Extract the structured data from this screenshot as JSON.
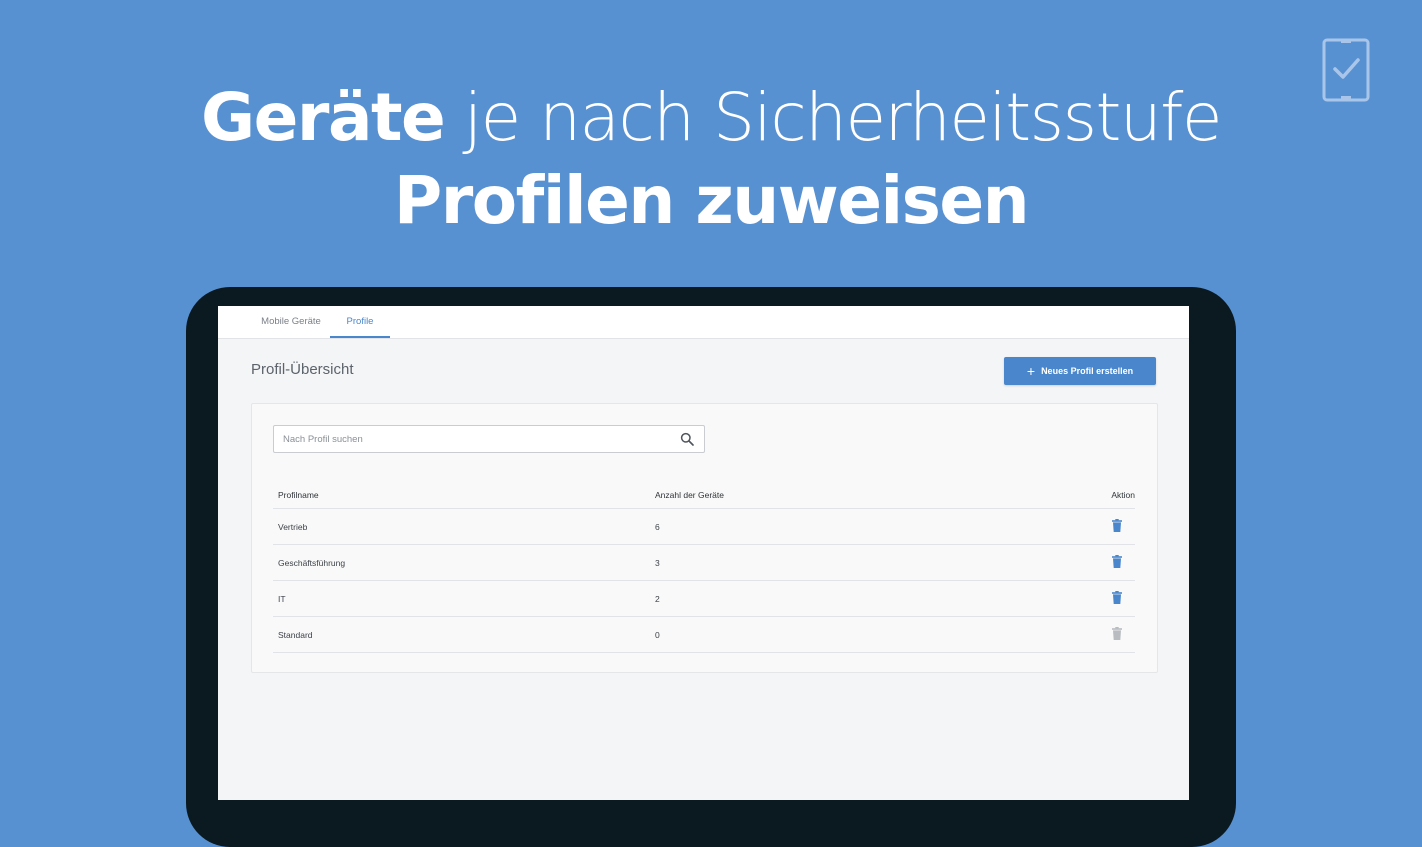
{
  "headline": {
    "line1_bold": "Geräte",
    "line1_rest": " je nach Sicherheitsstufe",
    "line2": "Profilen zuweisen"
  },
  "logo_icon": "tablet-check-icon",
  "tabs": [
    {
      "label": "Mobile Geräte",
      "active": false
    },
    {
      "label": "Profile",
      "active": true
    }
  ],
  "page_title": "Profil-Übersicht",
  "new_profile_button": {
    "icon": "plus-icon",
    "label": "Neues Profil erstellen"
  },
  "search": {
    "placeholder": "Nach Profil suchen",
    "value": "",
    "icon": "search-icon"
  },
  "table": {
    "headers": {
      "name": "Profilname",
      "count": "Anzahl der Geräte",
      "action": "Aktion"
    },
    "rows": [
      {
        "name": "Vertrieb",
        "count": "6",
        "delete_enabled": true
      },
      {
        "name": "Geschäftsführung",
        "count": "3",
        "delete_enabled": true
      },
      {
        "name": "IT",
        "count": "2",
        "delete_enabled": true
      },
      {
        "name": "Standard",
        "count": "0",
        "delete_enabled": false
      }
    ]
  },
  "colors": {
    "background": "#5891d2",
    "accent": "#4a86cc",
    "device_frame": "#0b1a21",
    "trash_disabled": "#b8bcc0"
  }
}
